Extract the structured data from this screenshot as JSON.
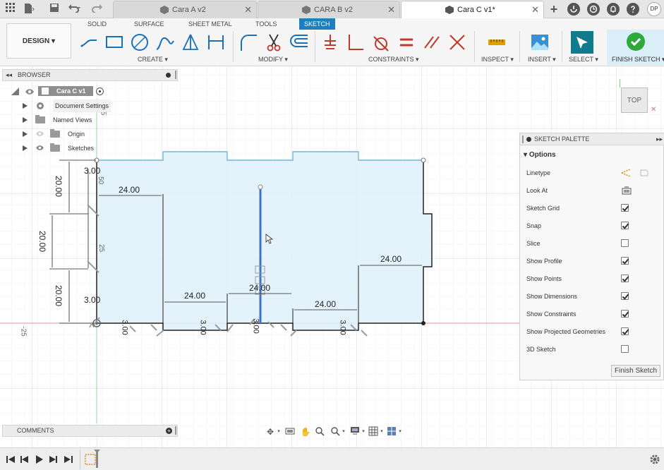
{
  "titlebar": {
    "tabs": [
      {
        "label": "Cara A v2",
        "active": false
      },
      {
        "label": "CARA B v2",
        "active": false
      },
      {
        "label": "Cara C v1*",
        "active": true
      }
    ],
    "close_glyph": "✕",
    "add_glyph": "+",
    "user_initials": "DP",
    "icons": [
      "app-grid-icon",
      "file-icon",
      "save-icon",
      "undo-icon",
      "redo-icon",
      "extensions-icon",
      "job-status-icon",
      "notifications-icon",
      "help-icon"
    ]
  },
  "ribbon": {
    "workspace": "DESIGN ▾",
    "tabs": [
      "SOLID",
      "SURFACE",
      "SHEET METAL",
      "TOOLS",
      "SKETCH"
    ],
    "active_tab": "SKETCH",
    "groups": {
      "create": "CREATE ▾",
      "modify": "MODIFY ▾",
      "constraints": "CONSTRAINTS ▾",
      "inspect": "INSPECT ▾",
      "insert": "INSERT ▾",
      "select": "SELECT ▾",
      "finish": "FINISH SKETCH ▾"
    }
  },
  "browser": {
    "title": "BROWSER",
    "root": "Cara C v1",
    "items": [
      "Document Settings",
      "Named Views",
      "Origin",
      "Sketches"
    ]
  },
  "sketch": {
    "dimensions": {
      "d_24_top_left": "24.00",
      "d_24_right": "24.00",
      "d_24_mid_left": "24.00",
      "d_24_mid": "24.00",
      "d_24_mid_right": "24.00",
      "d_20_a": "20.00",
      "d_20_b": "20.00",
      "d_20_c": "20.00",
      "d_3_top": "3.00",
      "d_3_bottom": "3.00",
      "d_3_v1": "3.00",
      "d_3_v2": "3.00",
      "d_3_v3": "3.00",
      "d_3_v4": "3.00"
    },
    "axis_labels": {
      "a5": "5",
      "a50": "50",
      "a25": "25",
      "neg25": "-25"
    }
  },
  "palette": {
    "title": "SKETCH PALETTE",
    "section": "Options",
    "rows": [
      {
        "label": "Linetype",
        "kind": "icon"
      },
      {
        "label": "Look At",
        "kind": "icon"
      },
      {
        "label": "Sketch Grid",
        "checked": true
      },
      {
        "label": "Snap",
        "checked": true
      },
      {
        "label": "Slice",
        "checked": false
      },
      {
        "label": "Show Profile",
        "checked": true
      },
      {
        "label": "Show Points",
        "checked": true
      },
      {
        "label": "Show Dimensions",
        "checked": true
      },
      {
        "label": "Show Constraints",
        "checked": true
      },
      {
        "label": "Show Projected Geometries",
        "checked": true
      },
      {
        "label": "3D Sketch",
        "checked": false
      }
    ],
    "finish_button": "Finish Sketch"
  },
  "viewcube": {
    "face": "TOP"
  },
  "comments": {
    "title": "COMMENTS"
  }
}
